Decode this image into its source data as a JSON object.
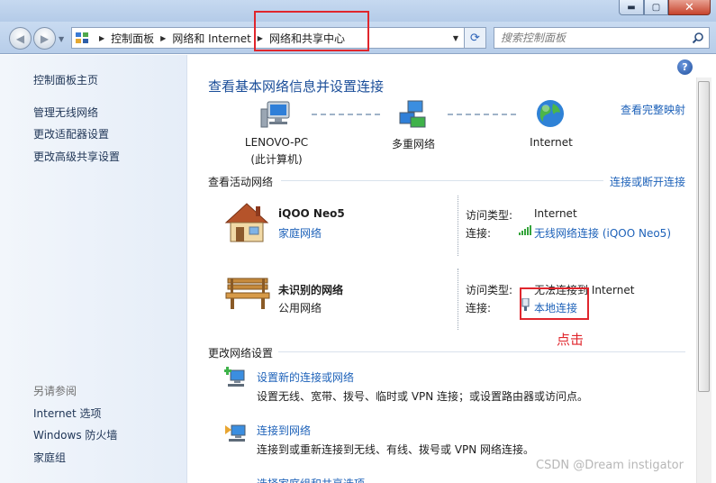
{
  "window": {
    "min_glyph": "▬",
    "max_glyph": "▢",
    "close_glyph": "✕"
  },
  "address": {
    "crumbs": [
      "控制面板",
      "网络和 Internet",
      "网络和共享中心"
    ],
    "search_placeholder": "搜索控制面板"
  },
  "sidebar": {
    "home": "控制面板主页",
    "items": [
      "管理无线网络",
      "更改适配器设置",
      "更改高级共享设置"
    ],
    "see_also_label": "另请参阅",
    "see_also": [
      "Internet 选项",
      "Windows 防火墙",
      "家庭组"
    ]
  },
  "main": {
    "title": "查看基本网络信息并设置连接",
    "view_full_map": "查看完整映射",
    "map": {
      "computer_name": "LENOVO-PC",
      "computer_sub": "(此计算机)",
      "middle": "多重网络",
      "internet": "Internet"
    },
    "active_heading": "查看活动网络",
    "connect_disconnect": "连接或断开连接",
    "networks": [
      {
        "name": "iQOO Neo5",
        "type": "家庭网络",
        "access_label": "访问类型:",
        "access_value": "Internet",
        "conn_label": "连接:",
        "conn_value": "无线网络连接 (iQOO Neo5)"
      },
      {
        "name": "未识别的网络",
        "type": "公用网络",
        "access_label": "访问类型:",
        "access_value": "无法连接到 Internet",
        "conn_label": "连接:",
        "conn_value": "本地连接"
      }
    ],
    "change_heading": "更改网络设置",
    "tasks": [
      {
        "title": "设置新的连接或网络",
        "desc": "设置无线、宽带、拨号、临时或 VPN 连接；或设置路由器或访问点。"
      },
      {
        "title": "连接到网络",
        "desc": "连接到或重新连接到无线、有线、拨号或 VPN 网络连接。"
      },
      {
        "title": "选择家庭组和共享选项",
        "desc": ""
      }
    ]
  },
  "annotation": {
    "click_text": "点击"
  },
  "watermark": "CSDN @Dream instigator",
  "colors": {
    "link": "#1e62b9",
    "title": "#1b4e99",
    "annotation_red": "#e0262d"
  },
  "icons": [
    "back-arrow-icon",
    "forward-arrow-icon",
    "control-panel-icon",
    "refresh-icon",
    "search-icon",
    "help-icon",
    "computer-icon",
    "multiple-networks-icon",
    "globe-icon",
    "house-icon",
    "bench-icon",
    "wireless-signal-icon",
    "wired-connection-icon",
    "new-connection-icon",
    "connect-network-icon"
  ]
}
